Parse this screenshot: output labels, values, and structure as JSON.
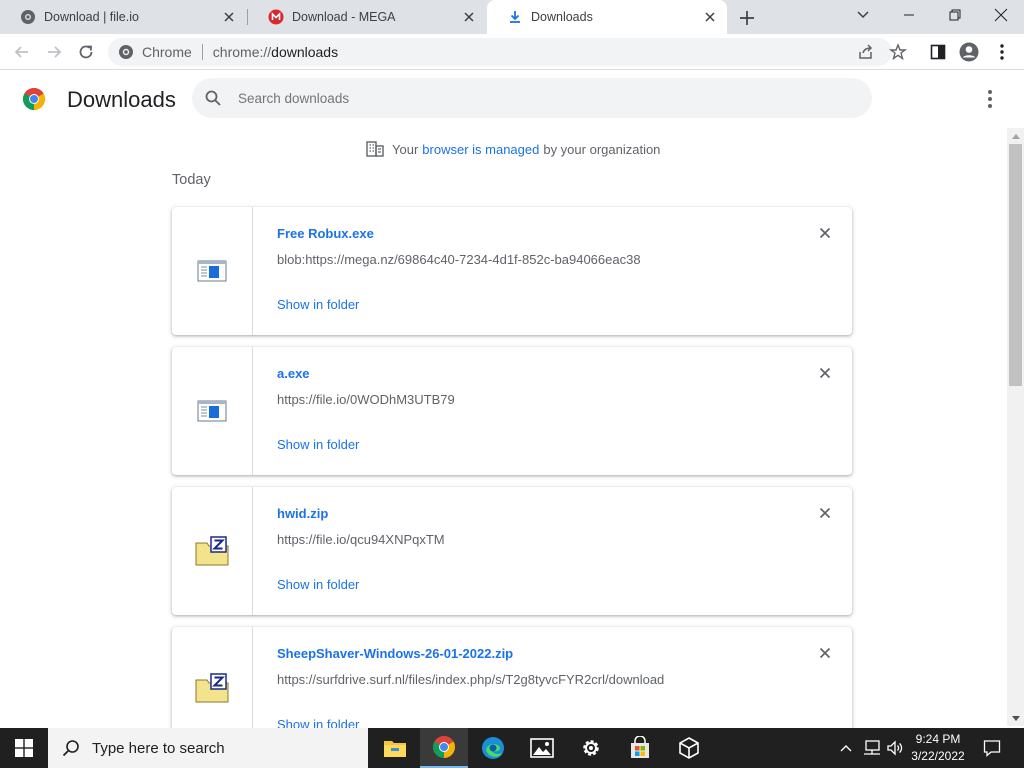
{
  "tabs": [
    {
      "title": "Download | file.io",
      "active": false
    },
    {
      "title": "Download - MEGA",
      "active": false
    },
    {
      "title": "Downloads",
      "active": true
    }
  ],
  "omnibox": {
    "site": "Chrome",
    "scheme": "chrome://",
    "path": "downloads"
  },
  "page": {
    "title": "Downloads",
    "search_placeholder": "Search downloads",
    "managed_prefix": "Your",
    "managed_link": "browser is managed",
    "managed_suffix": "by your organization",
    "section": "Today"
  },
  "downloads": [
    {
      "name": "Free Robux.exe",
      "url": "blob:https://mega.nz/69864c40-7234-4d1f-852c-ba94066eac38",
      "action": "Show in folder",
      "icon": "exe-window-icon"
    },
    {
      "name": "a.exe",
      "url": "https://file.io/0WODhM3UTB79",
      "action": "Show in folder",
      "icon": "exe-window-icon"
    },
    {
      "name": "hwid.zip",
      "url": "https://file.io/qcu94XNPqxTM",
      "action": "Show in folder",
      "icon": "zip-folder-icon"
    },
    {
      "name": "SheepShaver-Windows-26-01-2022.zip",
      "url": "https://surfdrive.surf.nl/files/index.php/s/T2g8tyvcFYR2crl/download",
      "action": "Show in folder",
      "icon": "zip-folder-icon"
    }
  ],
  "taskbar": {
    "search_placeholder": "Type here to search",
    "time": "9:24 PM",
    "date": "3/22/2022"
  },
  "colors": {
    "link": "#1a73e8",
    "tabstrip": "#dee1e6",
    "taskbar": "#202020"
  }
}
